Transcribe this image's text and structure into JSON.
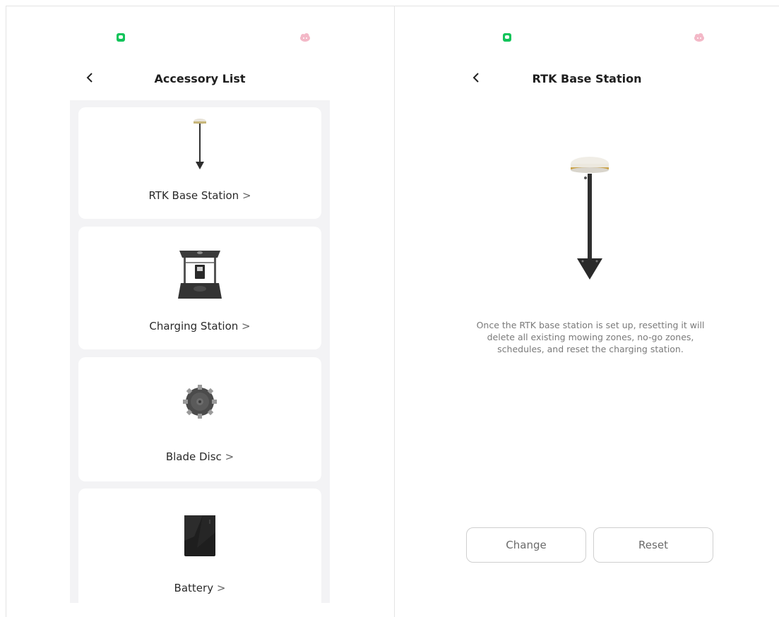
{
  "left_screen": {
    "title": "Accessory List",
    "back_icon": "chevron-left",
    "items": [
      {
        "label": "RTK Base Station",
        "icon": "rtk-base-station-image"
      },
      {
        "label": "Charging Station",
        "icon": "charging-station-image"
      },
      {
        "label": "Blade Disc",
        "icon": "blade-disc-image"
      },
      {
        "label": "Battery",
        "icon": "battery-image"
      }
    ],
    "chevron": ">"
  },
  "right_screen": {
    "title": "RTK Base Station",
    "back_icon": "chevron-left",
    "description": "Once the RTK base station is set up, resetting it will delete all existing mowing zones, no-go zones, schedules, and reset the charging station.",
    "change_label": "Change",
    "reset_label": "Reset"
  },
  "colors": {
    "list_background": "#f3f3f5",
    "card_background": "#ffffff",
    "status_green": "#12c45a",
    "status_pink": "#f3b8c7"
  }
}
